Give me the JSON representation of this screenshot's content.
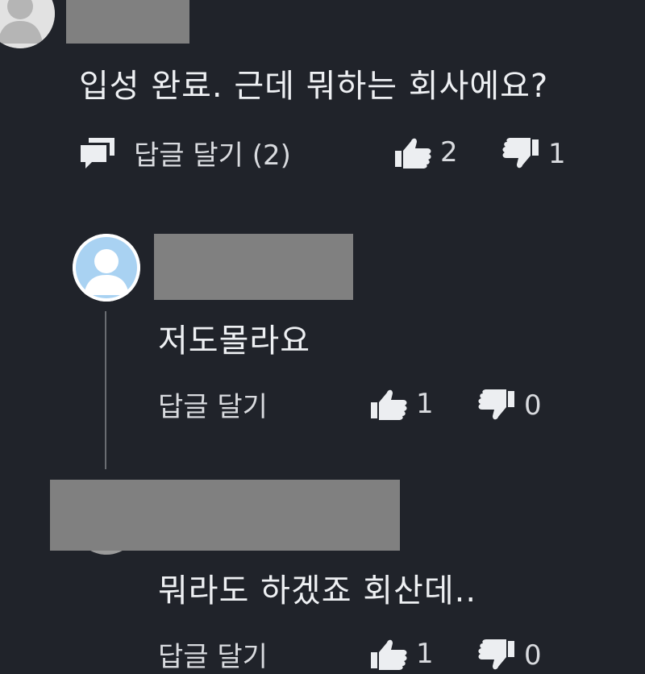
{
  "comments": [
    {
      "text": "입성 완료. 근데 뭐하는 회사에요?",
      "reply_label": "답글 달기 (2)",
      "like_count": "2",
      "dislike_count": "1",
      "replies": [
        {
          "text": "저도몰라요",
          "reply_label": "답글 달기",
          "like_count": "1",
          "dislike_count": "0"
        },
        {
          "text": "뭐라도 하겠죠 회산데..",
          "reply_label": "답글 달기",
          "like_count": "1",
          "dislike_count": "0"
        }
      ]
    }
  ],
  "icons": {
    "avatar": "user-avatar-icon",
    "reply": "speech-bubbles-icon",
    "like": "thumbs-up-icon",
    "dislike": "thumbs-down-icon"
  },
  "colors": {
    "background": "#20232a",
    "redaction": "#808080",
    "avatar_blue": "#a9d2f2",
    "avatar_gray": "#9b9b9b"
  }
}
